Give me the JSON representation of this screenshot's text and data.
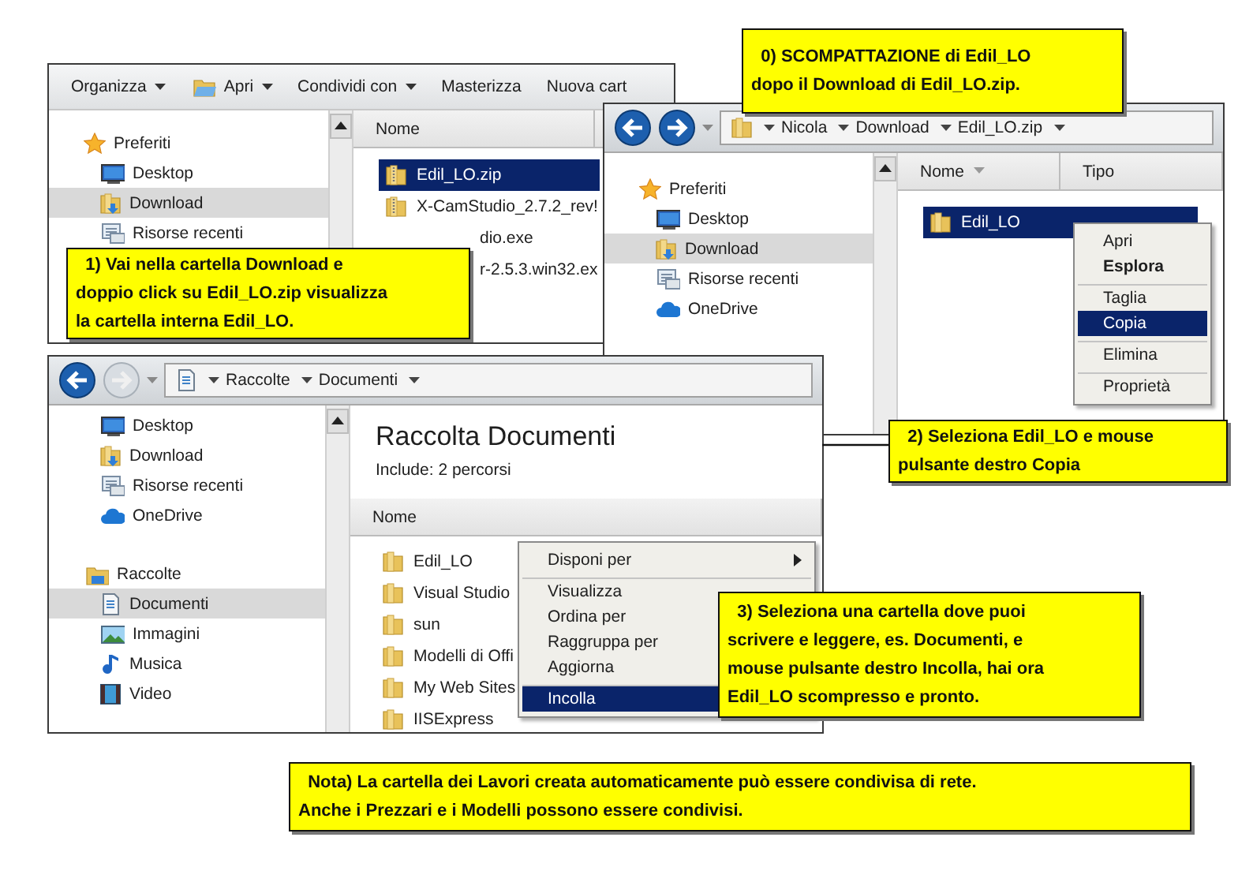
{
  "windows": [
    {
      "toolbar": [
        {
          "label": "Organizza",
          "dropdown": true
        },
        {
          "label": "Apri",
          "dropdown": true
        },
        {
          "label": "Condividi con",
          "dropdown": true
        },
        {
          "label": "Masterizza",
          "dropdown": false
        },
        {
          "label": "Nuova cart",
          "dropdown": false
        }
      ],
      "nav": [
        {
          "label": "Preferiti",
          "kind": "group",
          "selected": false
        },
        {
          "label": "Desktop",
          "kind": "item",
          "selected": false
        },
        {
          "label": "Download",
          "kind": "item",
          "selected": true
        },
        {
          "label": "Risorse recenti",
          "kind": "item",
          "selected": false
        }
      ],
      "columns": [
        {
          "label": "Nome",
          "sorted": false
        }
      ],
      "files": [
        {
          "name": "Edil_LO.zip",
          "selected": true
        },
        {
          "name": "X-CamStudio_2.7.2_rev!",
          "selected": false
        },
        {
          "name": "dio.exe",
          "selected": false
        },
        {
          "name": "r-2.5.3.win32.ex",
          "selected": false
        }
      ]
    },
    {
      "address": [
        "Nicola",
        "Download",
        "Edil_LO.zip"
      ],
      "forward_disabled": false,
      "nav": [
        {
          "label": "Preferiti",
          "kind": "group",
          "selected": false
        },
        {
          "label": "Desktop",
          "kind": "item",
          "selected": false
        },
        {
          "label": "Download",
          "kind": "item",
          "selected": true
        },
        {
          "label": "Risorse recenti",
          "kind": "item",
          "selected": false
        },
        {
          "label": "OneDrive",
          "kind": "item",
          "selected": false
        }
      ],
      "columns": [
        {
          "label": "Nome",
          "sorted": true
        },
        {
          "label": "Tipo",
          "sorted": false
        }
      ],
      "files": [
        {
          "name": "Edil_LO",
          "selected": true
        }
      ],
      "context_menu": [
        {
          "label": "Apri",
          "selected": false,
          "bold": false,
          "separator_before": false
        },
        {
          "label": "Esplora",
          "selected": false,
          "bold": true,
          "separator_before": false
        },
        {
          "label": "Taglia",
          "selected": false,
          "bold": false,
          "separator_before": true
        },
        {
          "label": "Copia",
          "selected": true,
          "bold": false,
          "separator_before": false
        },
        {
          "label": "Elimina",
          "selected": false,
          "bold": false,
          "separator_before": true
        },
        {
          "label": "Proprietà",
          "selected": false,
          "bold": false,
          "separator_before": true
        }
      ]
    },
    {
      "address": [
        "Raccolte",
        "Documenti"
      ],
      "forward_disabled": true,
      "nav": [
        {
          "label": "Desktop",
          "kind": "item",
          "selected": false
        },
        {
          "label": "Download",
          "kind": "item",
          "selected": false
        },
        {
          "label": "Risorse recenti",
          "kind": "item",
          "selected": false
        },
        {
          "label": "OneDrive",
          "kind": "item",
          "selected": false
        },
        {
          "label": "Raccolte",
          "kind": "group",
          "selected": false
        },
        {
          "label": "Documenti",
          "kind": "item",
          "selected": true
        },
        {
          "label": "Immagini",
          "kind": "item",
          "selected": false
        },
        {
          "label": "Musica",
          "kind": "item",
          "selected": false
        },
        {
          "label": "Video",
          "kind": "item",
          "selected": false
        }
      ],
      "heading": "Raccolta Documenti",
      "subheading": "Include:  2 percorsi",
      "columns": [
        {
          "label": "Nome",
          "sorted": false
        }
      ],
      "files": [
        {
          "name": "Edil_LO",
          "selected": false
        },
        {
          "name": "Visual Studio",
          "selected": false
        },
        {
          "name": "sun",
          "selected": false
        },
        {
          "name": "Modelli di Offi",
          "selected": false
        },
        {
          "name": "My Web Sites",
          "selected": false
        },
        {
          "name": "IISExpress",
          "selected": false
        }
      ],
      "context_menu": [
        {
          "label": "Disponi per",
          "selected": false,
          "bold": false,
          "submenu": true,
          "separator_before": false
        },
        {
          "label": "Visualizza",
          "selected": false,
          "bold": false,
          "separator_before": true
        },
        {
          "label": "Ordina per",
          "selected": false,
          "bold": false,
          "separator_before": false
        },
        {
          "label": "Raggruppa per",
          "selected": false,
          "bold": false,
          "separator_before": false
        },
        {
          "label": "Aggiorna",
          "selected": false,
          "bold": false,
          "separator_before": false
        },
        {
          "label": "Incolla",
          "selected": true,
          "bold": false,
          "separator_before": true
        }
      ]
    }
  ],
  "callouts": [
    {
      "lines": [
        "0) SCOMPATTAZIONE di Edil_LO",
        "dopo il Download di Edil_LO.zip."
      ]
    },
    {
      "lines": [
        "1) Vai nella cartella Download e",
        "doppio click su Edil_LO.zip visualizza",
        "la cartella interna Edil_LO."
      ]
    },
    {
      "lines": [
        "2) Seleziona Edil_LO e mouse",
        "pulsante destro Copia"
      ]
    },
    {
      "lines": [
        "3) Seleziona una cartella dove puoi",
        "scrivere e leggere, es. Documenti, e",
        "mouse pulsante destro Incolla, hai ora",
        "Edil_LO scompresso e pronto."
      ]
    },
    {
      "lines": [
        "Nota) La cartella dei Lavori creata automaticamente può essere condivisa di rete.",
        "Anche i Prezzari e i Modelli possono essere condivisi."
      ]
    }
  ]
}
